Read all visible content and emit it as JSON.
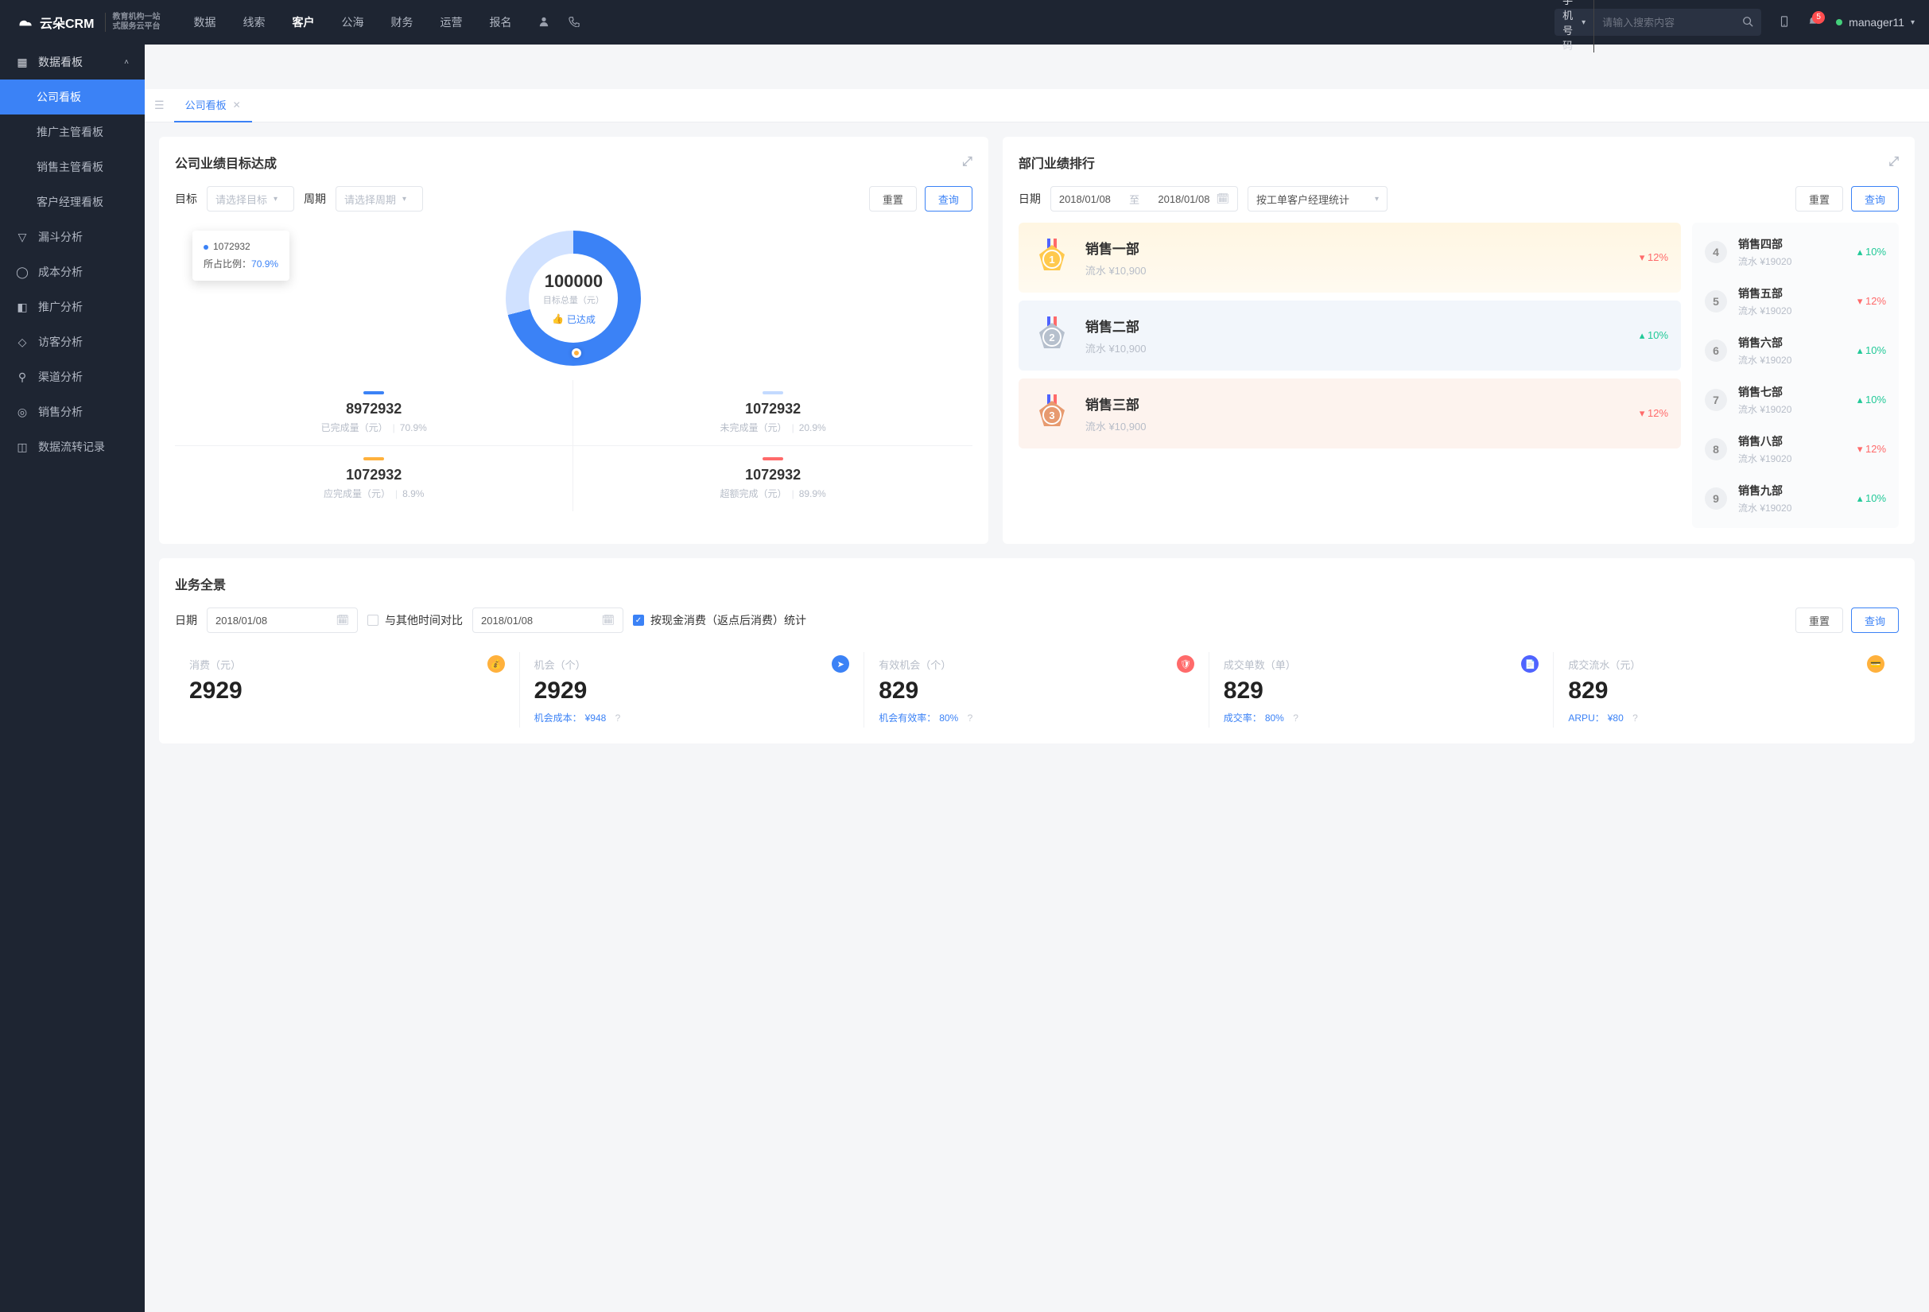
{
  "header": {
    "logo_main": "云朵CRM",
    "logo_sub": "教育机构一站\n式服务云平台",
    "nav": [
      "数据",
      "线索",
      "客户",
      "公海",
      "财务",
      "运营",
      "报名"
    ],
    "nav_active_index": 2,
    "search_type": "手机号码",
    "search_placeholder": "请输入搜索内容",
    "notif_count": "5",
    "user": "manager11"
  },
  "sidebar": {
    "group_title": "数据看板",
    "sub": [
      "公司看板",
      "推广主管看板",
      "销售主管看板",
      "客户经理看板"
    ],
    "items": [
      "漏斗分析",
      "成本分析",
      "推广分析",
      "访客分析",
      "渠道分析",
      "销售分析",
      "数据流转记录"
    ]
  },
  "tab": {
    "label": "公司看板"
  },
  "target_card": {
    "title": "公司业绩目标达成",
    "target_lbl": "目标",
    "target_ph": "请选择目标",
    "period_lbl": "周期",
    "period_ph": "请选择周期",
    "reset": "重置",
    "query": "查询",
    "donut_total": "100000",
    "donut_total_lbl": "目标总量（元）",
    "achieved": "已达成",
    "tooltip_val": "1072932",
    "tooltip_lbl": "所占比例：",
    "tooltip_pct": "70.9%",
    "cells": [
      {
        "color": "#3b82f6",
        "v": "8972932",
        "lbl": "已完成量（元）",
        "pct": "70.9%"
      },
      {
        "color": "#c3daff",
        "v": "1072932",
        "lbl": "未完成量（元）",
        "pct": "20.9%"
      },
      {
        "color": "#ffb13c",
        "v": "1072932",
        "lbl": "应完成量（元）",
        "pct": "8.9%"
      },
      {
        "color": "#ff6a6a",
        "v": "1072932",
        "lbl": "超额完成（元）",
        "pct": "89.9%"
      }
    ]
  },
  "rank_card": {
    "title": "部门业绩排行",
    "date_lbl": "日期",
    "date1": "2018/01/08",
    "date_sep": "至",
    "date2": "2018/01/08",
    "select_val": "按工单客户经理统计",
    "reset": "重置",
    "query": "查询",
    "top3": [
      {
        "rank": "1",
        "name": "销售一部",
        "sub": "流水 ¥10,900",
        "dir": "down",
        "pct": "12%"
      },
      {
        "rank": "2",
        "name": "销售二部",
        "sub": "流水 ¥10,900",
        "dir": "up",
        "pct": "10%"
      },
      {
        "rank": "3",
        "name": "销售三部",
        "sub": "流水 ¥10,900",
        "dir": "down",
        "pct": "12%"
      }
    ],
    "list": [
      {
        "rank": "4",
        "name": "销售四部",
        "sub": "流水 ¥19020",
        "dir": "up",
        "pct": "10%"
      },
      {
        "rank": "5",
        "name": "销售五部",
        "sub": "流水 ¥19020",
        "dir": "down",
        "pct": "12%"
      },
      {
        "rank": "6",
        "name": "销售六部",
        "sub": "流水 ¥19020",
        "dir": "up",
        "pct": "10%"
      },
      {
        "rank": "7",
        "name": "销售七部",
        "sub": "流水 ¥19020",
        "dir": "up",
        "pct": "10%"
      },
      {
        "rank": "8",
        "name": "销售八部",
        "sub": "流水 ¥19020",
        "dir": "down",
        "pct": "12%"
      },
      {
        "rank": "9",
        "name": "销售九部",
        "sub": "流水 ¥19020",
        "dir": "up",
        "pct": "10%"
      }
    ]
  },
  "overview": {
    "title": "业务全景",
    "date_lbl": "日期",
    "date1": "2018/01/08",
    "cmp_lbl": "与其他时间对比",
    "date2": "2018/01/08",
    "chk_lbl": "按现金消费（返点后消费）统计",
    "reset": "重置",
    "query": "查询",
    "tiles": [
      {
        "lbl": "消费（元）",
        "ic": "#ffb13c",
        "val": "2929",
        "btm_l": "",
        "btm_v": ""
      },
      {
        "lbl": "机会（个）",
        "ic": "#3b82f6",
        "val": "2929",
        "btm_l": "机会成本：",
        "btm_v": "¥948"
      },
      {
        "lbl": "有效机会（个）",
        "ic": "#ff6a6a",
        "val": "829",
        "btm_l": "机会有效率：",
        "btm_v": "80%"
      },
      {
        "lbl": "成交单数（单）",
        "ic": "#4f63ff",
        "val": "829",
        "btm_l": "成交率：",
        "btm_v": "80%"
      },
      {
        "lbl": "成交流水（元）",
        "ic": "#ffb13c",
        "val": "829",
        "btm_l": "ARPU：",
        "btm_v": "¥80"
      }
    ]
  },
  "chart_data": {
    "type": "pie",
    "title": "公司业绩目标达成",
    "total_label": "目标总量（元）",
    "total": 100000,
    "series": [
      {
        "name": "已完成量（元）",
        "value": 8972932,
        "ratio_pct": 70.9,
        "color": "#3b82f6"
      },
      {
        "name": "未完成量（元）",
        "value": 1072932,
        "ratio_pct": 20.9,
        "color": "#c3daff"
      },
      {
        "name": "应完成量（元）",
        "value": 1072932,
        "ratio_pct": 8.9,
        "color": "#ffb13c"
      },
      {
        "name": "超额完成（元）",
        "value": 1072932,
        "ratio_pct": 89.9,
        "color": "#ff6a6a"
      }
    ],
    "tooltip": {
      "value": 1072932,
      "ratio_pct": 70.9
    },
    "status": "已达成"
  }
}
